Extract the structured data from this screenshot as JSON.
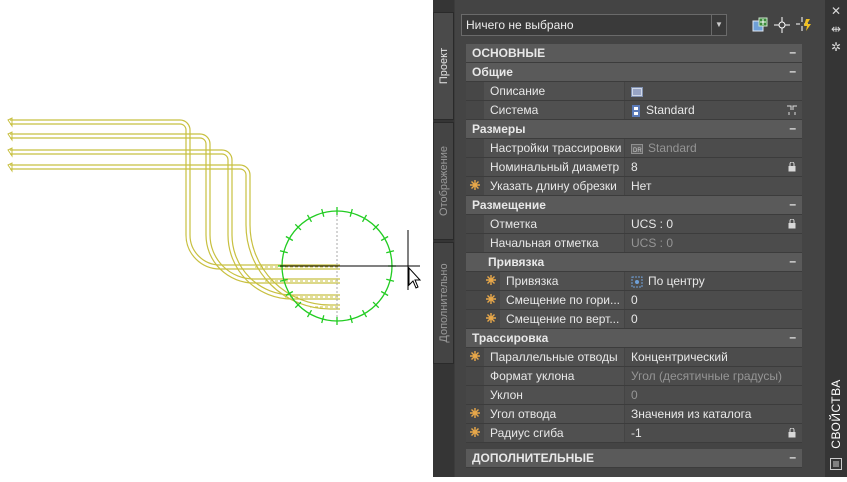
{
  "canvas": {
    "title": "Drawing area with pipe routes"
  },
  "palette": {
    "title": "СВОЙСТВА",
    "tabs": [
      "Проект",
      "Отображение",
      "Дополнительно"
    ],
    "selection": "Ничего не выбрано",
    "sections": {
      "main": "ОСНОВНЫЕ",
      "general": "Общие",
      "sizes": "Размеры",
      "placement": "Размещение",
      "anchor": "Привязка",
      "routing": "Трассировка",
      "additional": "ДОПОЛНИТЕЛЬНЫЕ"
    },
    "collapse_symbol": "–",
    "props": {
      "description": {
        "name": "Описание",
        "value": ""
      },
      "system": {
        "name": "Система",
        "value": "Standard"
      },
      "routing_settings": {
        "name": "Настройки трассировки",
        "value": "Standard"
      },
      "nominal_diameter": {
        "name": "Номинальный диаметр",
        "value": "8"
      },
      "cut_length": {
        "name": "Указать длину обрезки",
        "value": "Нет"
      },
      "elevation": {
        "name": "Отметка",
        "value": "UCS : 0"
      },
      "start_elevation": {
        "name": "Начальная отметка",
        "value": "UCS : 0"
      },
      "anchor": {
        "name": "Привязка",
        "value": "По центру"
      },
      "offset_h": {
        "name": "Смещение  по  гори...",
        "value": "0"
      },
      "offset_v": {
        "name": "Смещение  по  верт...",
        "value": "0"
      },
      "parallel": {
        "name": "Параллельные отводы",
        "value": "Концентрический"
      },
      "slope_format": {
        "name": "Формат уклона",
        "value": "Угол (десятичные градусы)"
      },
      "slope": {
        "name": "Уклон",
        "value": "0"
      },
      "bend_angle": {
        "name": "Угол отвода",
        "value": "Значения из каталога"
      },
      "bend_radius": {
        "name": "Радиус сгиба",
        "value": "-1"
      }
    },
    "colors": {
      "accent_star": "#e8a84a",
      "pipe": "#d4cc44",
      "snap_circle": "#22cc22"
    }
  }
}
